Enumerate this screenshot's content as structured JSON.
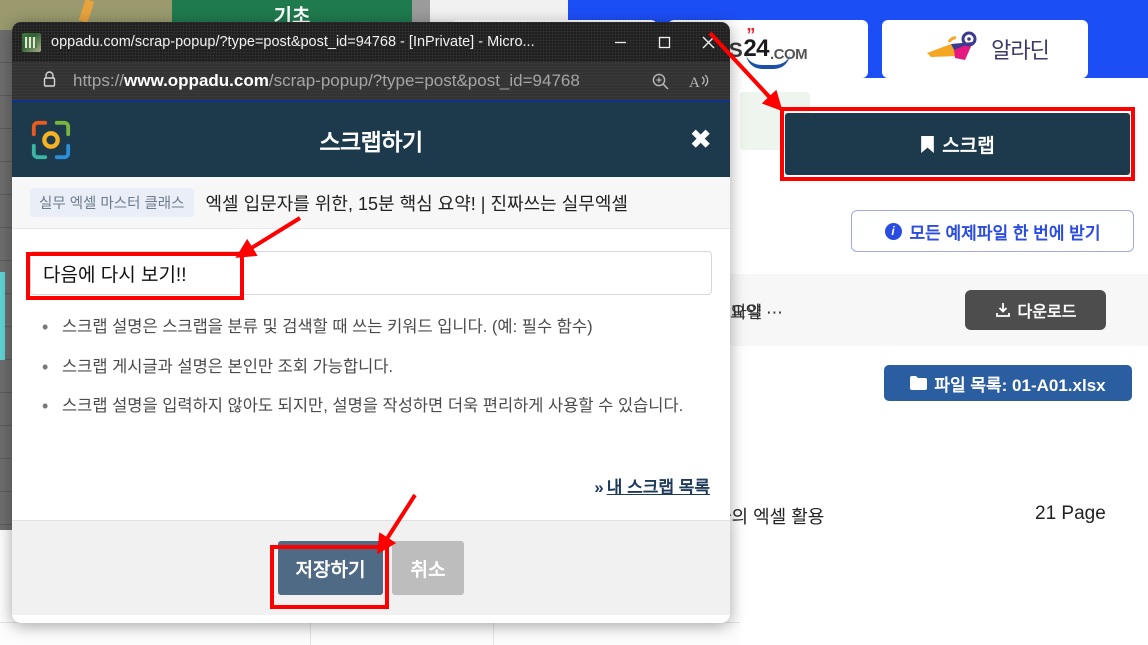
{
  "browser": {
    "tab_title": "oppadu.com/scrap-popup/?type=post&post_id=94768 - [InPrivate] - Micro...",
    "favicon_name": "site-favicon",
    "minimize_label": "—",
    "maximize_label": "□",
    "close_label": "×",
    "url_prefix": "https://",
    "url_domain": "www.oppadu.com",
    "url_path": "/scrap-popup/?type=post&post_id=94768",
    "lock_icon": "lock-icon",
    "zoom_icon": "zoom-in-icon",
    "read_aloud_icon": "read-aloud-icon"
  },
  "dialog": {
    "title": "스크랩하기",
    "close_glyph": "✖",
    "logo_name": "oppadu-logo",
    "post_category": "실무 엑셀 마스터 클래스",
    "post_title": "엑셀 입문자를 위한, 15분 핵심 요약! | 진짜쓰는 실무엑셀",
    "input_value": "다음에 다시 보기!!",
    "input_placeholder": "",
    "hints": [
      "스크랩 설명은 스크랩을 분류 및 검색할 때 쓰는 키워드 입니다. (예: 필수 함수)",
      "스크랩 게시글과 설명은 본인만 조회 가능합니다.",
      "스크랩 설명을 입력하지 않아도 되지만, 설명을 작성하면 더욱 편리하게 사용할 수 있습니다."
    ],
    "my_scrap_link": "내 스크랩 목록",
    "my_scrap_chevron": "»",
    "save_label": "저장하기",
    "cancel_label": "취소"
  },
  "background": {
    "partners": [
      {
        "name": "yes24",
        "text_main": "24",
        "text_suffix": ".COM",
        "text_prefix": "S"
      },
      {
        "name": "aladin",
        "label": "알라딘"
      }
    ],
    "scrap_button_label": "스크랩",
    "scrap_bookmark_icon": "bookmark-icon",
    "all_examples_label": "모든 예제파일 한 번에 받기",
    "info_icon": "info-icon",
    "info_glyph": "i",
    "file_row_summary": "요약 ⋯",
    "file_row_label": "완성파일",
    "download_label": "다운로드",
    "download_icon": "download-icon",
    "file_list_label": "파일 목록: 01-A01.xlsx",
    "folder_icon": "folder-icon",
    "course_title": "자의 엑셀 활용",
    "page_count": "21 Page",
    "sign_text": "기초"
  },
  "annotations": {
    "highlight_color": "#fe0000",
    "boxes": [
      "scrap-description-input",
      "save-button",
      "page-scrap-button"
    ],
    "arrows": [
      "arrow-to-input",
      "arrow-to-save-button",
      "arrow-to-scrap-button"
    ]
  }
}
